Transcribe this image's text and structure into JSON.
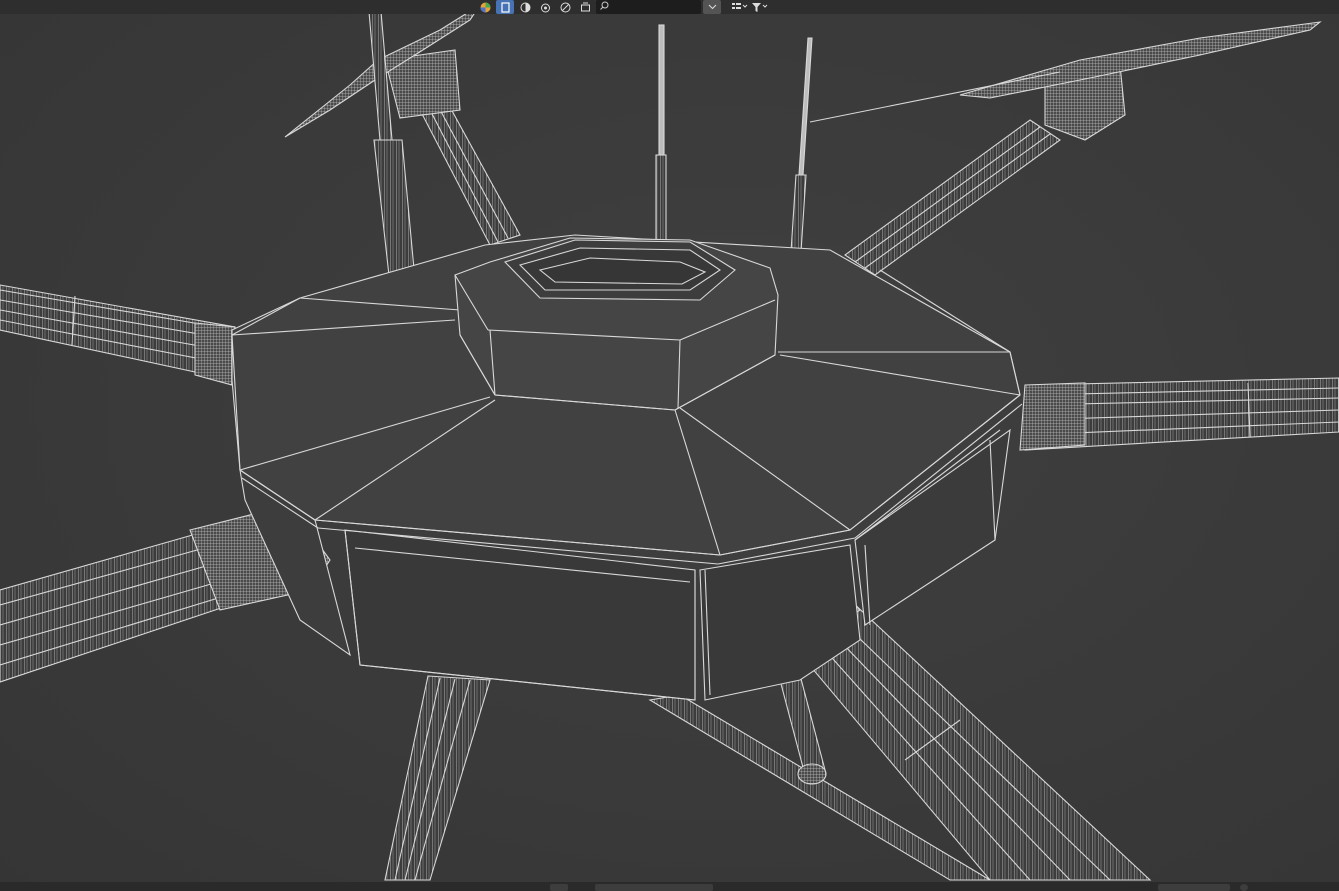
{
  "outliner": {
    "search": {
      "value": "",
      "placeholder": ""
    },
    "toolbar_icons": [
      "rainbow-ball-icon",
      "selectable-toggle-icon",
      "viewport-display-icon",
      "render-display-icon",
      "holdout-icon",
      "indirect-only-icon"
    ],
    "filter_icon": "funnel-icon",
    "display_mode_icon": "list-view-icon"
  },
  "viewport": {
    "shading_mode": "wireframe",
    "subject": "hexacopter-drone-model",
    "colors": {
      "background": "#3a3a3a",
      "wire": "#d8d8d8",
      "header": "#2e2e2e",
      "accent": "#4772b3"
    }
  }
}
